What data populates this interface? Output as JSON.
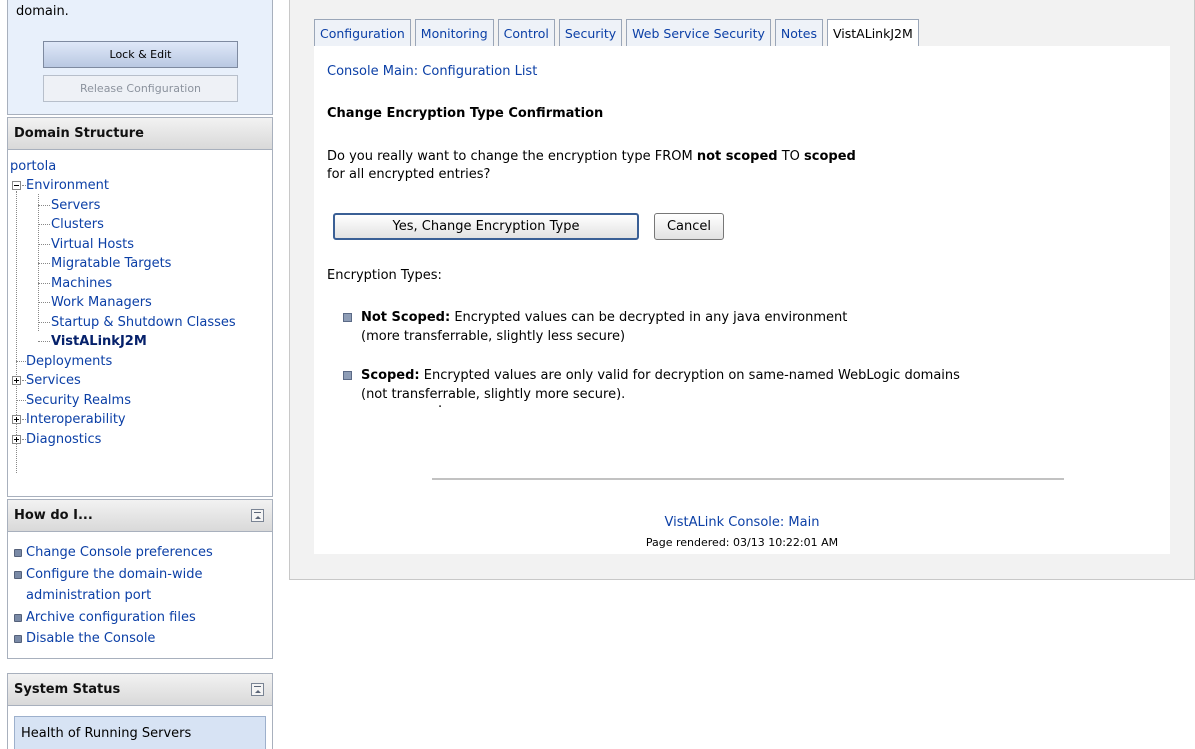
{
  "change_center": {
    "text": "domain.",
    "lock_edit_label": "Lock & Edit",
    "release_config_label": "Release Configuration"
  },
  "domain_structure": {
    "title": "Domain Structure",
    "root": "portola",
    "environment": "Environment",
    "env_children": [
      "Servers",
      "Clusters",
      "Virtual Hosts",
      "Migratable Targets",
      "Machines",
      "Work Managers",
      "Startup & Shutdown Classes",
      "VistALinkJ2M"
    ],
    "deployments": "Deployments",
    "services": "Services",
    "security_realms": "Security Realms",
    "interoperability": "Interoperability",
    "diagnostics": "Diagnostics"
  },
  "how_do_i": {
    "title": "How do I...",
    "items": [
      "Change Console preferences",
      "Configure the domain-wide",
      "administration port",
      "Archive configuration files",
      "Disable the Console"
    ]
  },
  "system_status": {
    "title": "System Status",
    "health_label": "Health of Running Servers"
  },
  "tabs": [
    "Configuration",
    "Monitoring",
    "Control",
    "Security",
    "Web Service Security",
    "Notes",
    "VistALinkJ2M"
  ],
  "active_tab": "VistALinkJ2M",
  "content": {
    "breadcrumb": "Console Main: Configuration List",
    "title": "Change Encryption Type Confirmation",
    "question_pre": "Do you really want to change the encryption type FROM ",
    "question_from": "not scoped",
    "question_mid": " TO ",
    "question_to": "scoped",
    "question_line2": "for all encrypted entries?",
    "yes_button": "Yes, Change Encryption Type",
    "cancel_button": "Cancel",
    "enc_types_label": "Encryption Types:",
    "not_scoped_term": "Not Scoped:",
    "not_scoped_desc": " Encrypted values can be decrypted in any java environment",
    "not_scoped_note": "(more transferrable, slightly less secure)",
    "scoped_term": "Scoped:",
    "scoped_desc": " Encrypted values are only valid for decryption on same-named WebLogic domains",
    "scoped_note": "(not transferrable, slightly more secure).",
    "footer_link": "VistALink Console: Main",
    "footer_rendered": "Page rendered: 03/13 10:22:01 AM"
  }
}
